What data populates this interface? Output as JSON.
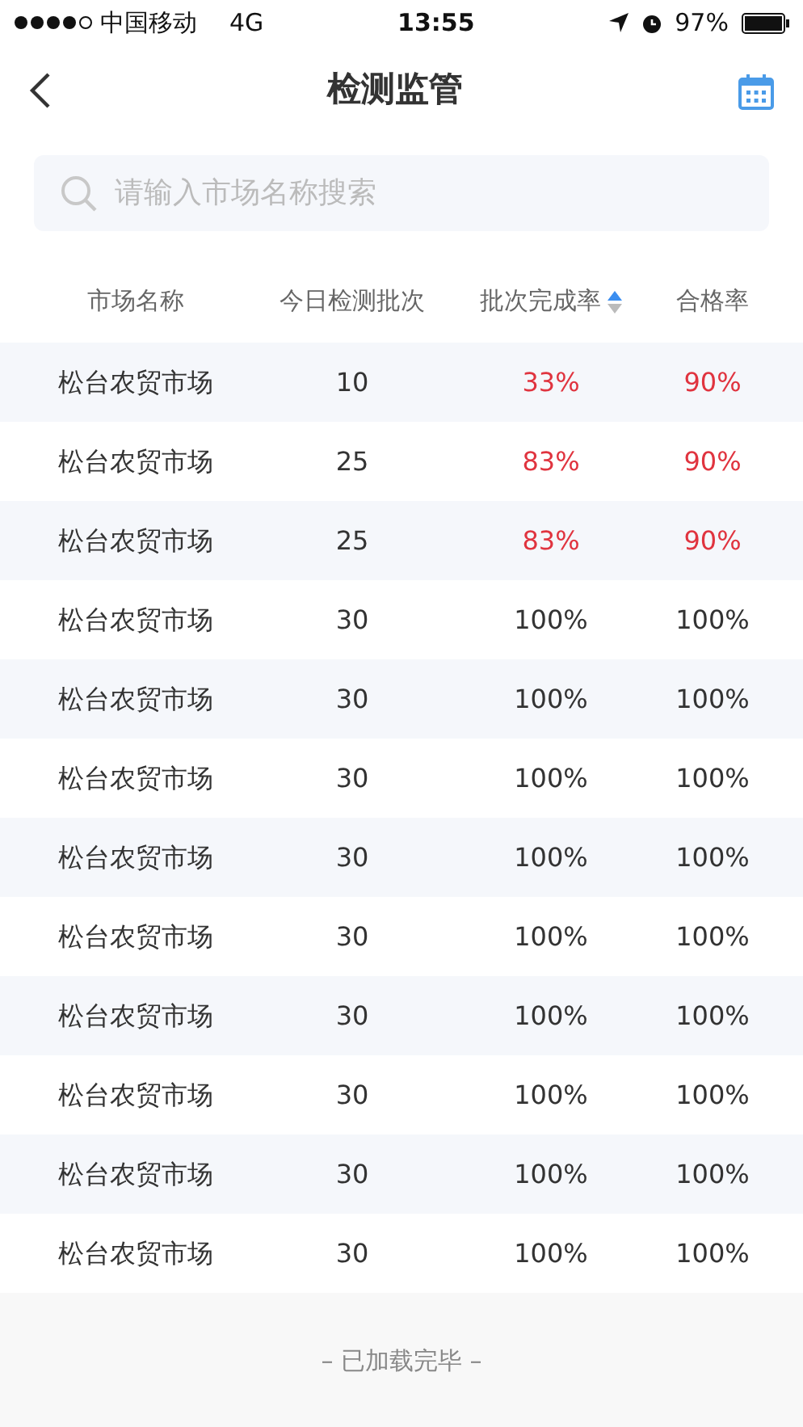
{
  "status_bar": {
    "carrier": "中国移动",
    "network": "4G",
    "time": "13:55",
    "battery": "97%"
  },
  "nav": {
    "title": "检测监管"
  },
  "search": {
    "placeholder": "请输入市场名称搜索"
  },
  "table": {
    "columns": [
      {
        "label": "市场名称",
        "sorted": false
      },
      {
        "label": "今日检测批次",
        "sorted": false
      },
      {
        "label": "批次完成率",
        "sorted": true
      },
      {
        "label": "合格率",
        "sorted": false
      }
    ],
    "rows": [
      {
        "market": "松台农贸市场",
        "batches": "10",
        "completion": {
          "text": "33%",
          "warn": true
        },
        "pass_rate": {
          "text": "90%",
          "warn": true
        }
      },
      {
        "market": "松台农贸市场",
        "batches": "25",
        "completion": {
          "text": "83%",
          "warn": true
        },
        "pass_rate": {
          "text": "90%",
          "warn": true
        }
      },
      {
        "market": "松台农贸市场",
        "batches": "25",
        "completion": {
          "text": "83%",
          "warn": true
        },
        "pass_rate": {
          "text": "90%",
          "warn": true
        }
      },
      {
        "market": "松台农贸市场",
        "batches": "30",
        "completion": {
          "text": "100%",
          "warn": false
        },
        "pass_rate": {
          "text": "100%",
          "warn": false
        }
      },
      {
        "market": "松台农贸市场",
        "batches": "30",
        "completion": {
          "text": "100%",
          "warn": false
        },
        "pass_rate": {
          "text": "100%",
          "warn": false
        }
      },
      {
        "market": "松台农贸市场",
        "batches": "30",
        "completion": {
          "text": "100%",
          "warn": false
        },
        "pass_rate": {
          "text": "100%",
          "warn": false
        }
      },
      {
        "market": "松台农贸市场",
        "batches": "30",
        "completion": {
          "text": "100%",
          "warn": false
        },
        "pass_rate": {
          "text": "100%",
          "warn": false
        }
      },
      {
        "market": "松台农贸市场",
        "batches": "30",
        "completion": {
          "text": "100%",
          "warn": false
        },
        "pass_rate": {
          "text": "100%",
          "warn": false
        }
      },
      {
        "market": "松台农贸市场",
        "batches": "30",
        "completion": {
          "text": "100%",
          "warn": false
        },
        "pass_rate": {
          "text": "100%",
          "warn": false
        }
      },
      {
        "market": "松台农贸市场",
        "batches": "30",
        "completion": {
          "text": "100%",
          "warn": false
        },
        "pass_rate": {
          "text": "100%",
          "warn": false
        }
      },
      {
        "market": "松台农贸市场",
        "batches": "30",
        "completion": {
          "text": "100%",
          "warn": false
        },
        "pass_rate": {
          "text": "100%",
          "warn": false
        }
      },
      {
        "market": "松台农贸市场",
        "batches": "30",
        "completion": {
          "text": "100%",
          "warn": false
        },
        "pass_rate": {
          "text": "100%",
          "warn": false
        }
      }
    ]
  },
  "footer": {
    "text": "– 已加载完毕 –"
  }
}
